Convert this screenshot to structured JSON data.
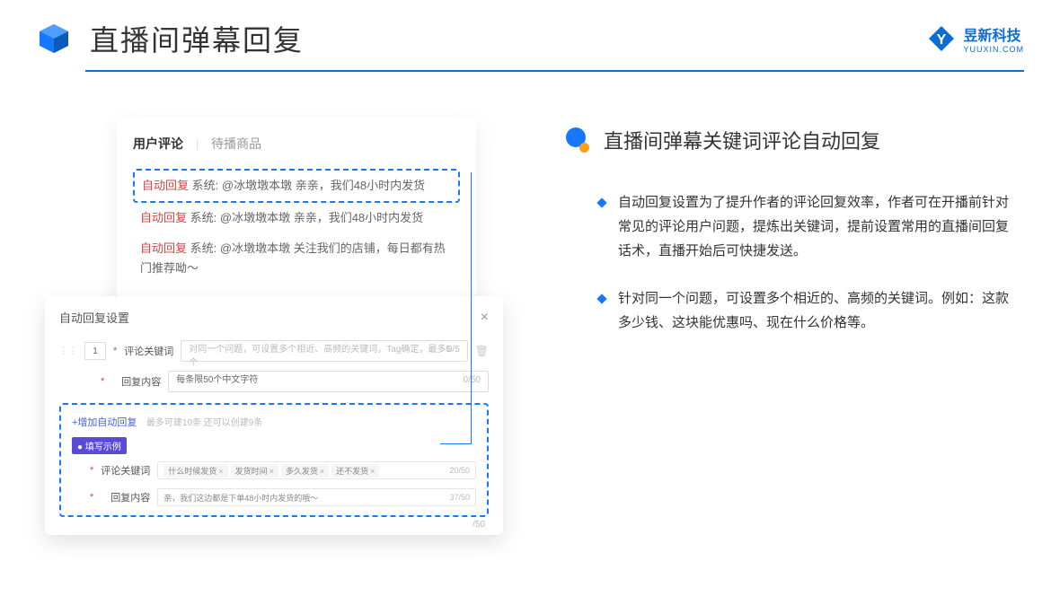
{
  "header": {
    "title": "直播间弹幕回复",
    "logo_main": "昱新科技",
    "logo_sub": "YUUXIN.COM"
  },
  "card1": {
    "tab_active": "用户评论",
    "tab_inactive": "待播商品",
    "tag": "自动回复",
    "system_prefix": "系统:",
    "comment1": "@冰墩墩本墩 亲亲，我们48小时内发货",
    "comment2": "@冰墩墩本墩 亲亲，我们48小时内发货",
    "comment3": "@冰墩墩本墩 关注我们的店铺，每日都有热门推荐呦～"
  },
  "card2": {
    "modal_title": "自动回复设置",
    "order": "1",
    "label_keyword": "评论关键词",
    "placeholder_keyword": "对同一个问题，可设置多个相近、高频的关键词，Tag确定，最多5个",
    "count_keyword": "0/5",
    "label_content": "回复内容",
    "placeholder_content": "每条限50个中文字符",
    "count_content": "0/50",
    "add_label": "+增加自动回复",
    "add_note": "最多可建10条 还可以创建9条",
    "example_badge": "● 填写示例",
    "tag1": "什么时候发货",
    "tag2": "发货时间",
    "tag3": "多久发货",
    "tag4": "还不发货",
    "ex_count1": "20/50",
    "ex_content": "亲，我们这边都是下单48小时内发货的哦～",
    "ex_count2": "37/50",
    "outside_count": "/50"
  },
  "right": {
    "title": "直播间弹幕关键词评论自动回复",
    "bullet1": "自动回复设置为了提升作者的评论回复效率，作者可在开播前针对常见的评论用户问题，提炼出关键词，提前设置常用的直播间回复话术，直播开始后可快捷发送。",
    "bullet2": "针对同一个问题，可设置多个相近的、高频的关键词。例如：这款多少钱、这块能优惠吗、现在什么价格等。"
  }
}
